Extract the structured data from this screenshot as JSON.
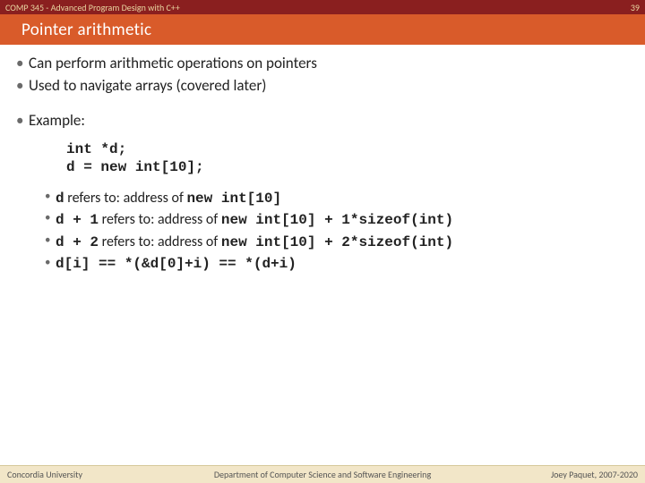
{
  "header": {
    "course": "COMP 345 - Advanced Program Design with C++",
    "pagenum": "39",
    "title": "Pointer arithmetic"
  },
  "bullets": [
    "Can perform arithmetic operations on pointers",
    "Used to navigate arrays (covered later)"
  ],
  "example_label": "Example:",
  "code": "int *d;\nd = new int[10];",
  "sub": {
    "l1_pre": "d",
    "l1_mid": " refers to: address of ",
    "l1_post": "new int[10]",
    "l2_pre": "d + 1",
    "l2_mid": " refers to: address of ",
    "l2_post": "new int[10] + 1*sizeof(int)",
    "l3_pre": "d + 2",
    "l3_mid": " refers to: address of ",
    "l3_post": "new int[10] + 2*sizeof(int)",
    "l4": "d[i] == *(&d[0]+i) == *(d+i)"
  },
  "footer": {
    "left": "Concordia University",
    "mid": "Department of Computer Science and Software Engineering",
    "right": "Joey Paquet, 2007-2020"
  }
}
